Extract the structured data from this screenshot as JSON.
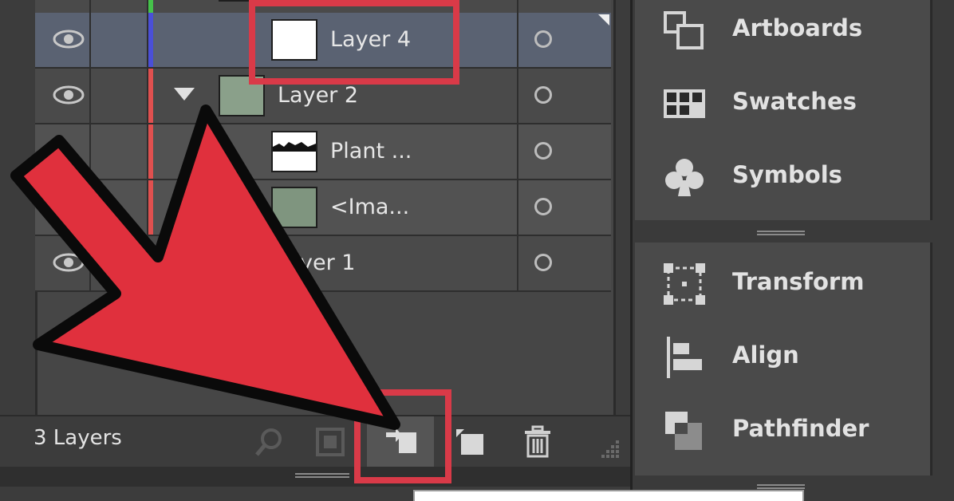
{
  "layers": {
    "rows": [
      {
        "name": "Layer 4",
        "color": "#4a4fd8"
      },
      {
        "name": "Layer 2",
        "color": "#e0504f"
      },
      {
        "name": "Plant ...",
        "color": "#e0504f"
      },
      {
        "name": "<Ima...",
        "color": "#e0504f"
      },
      {
        "name": "yer 1",
        "color": "#e0504f"
      }
    ],
    "top_color": "#45c24a",
    "count_label": "3 Layers"
  },
  "dock": {
    "group1": [
      {
        "label": "Artboards",
        "icon": "artboards-icon"
      },
      {
        "label": "Swatches",
        "icon": "swatches-icon"
      },
      {
        "label": "Symbols",
        "icon": "symbols-icon"
      }
    ],
    "group2": [
      {
        "label": "Transform",
        "icon": "transform-icon"
      },
      {
        "label": "Align",
        "icon": "align-icon"
      },
      {
        "label": "Pathfinder",
        "icon": "pathfinder-icon"
      }
    ]
  },
  "annotation": {
    "arrow_color": "#e0303d",
    "highlight_color": "#d93a48"
  }
}
